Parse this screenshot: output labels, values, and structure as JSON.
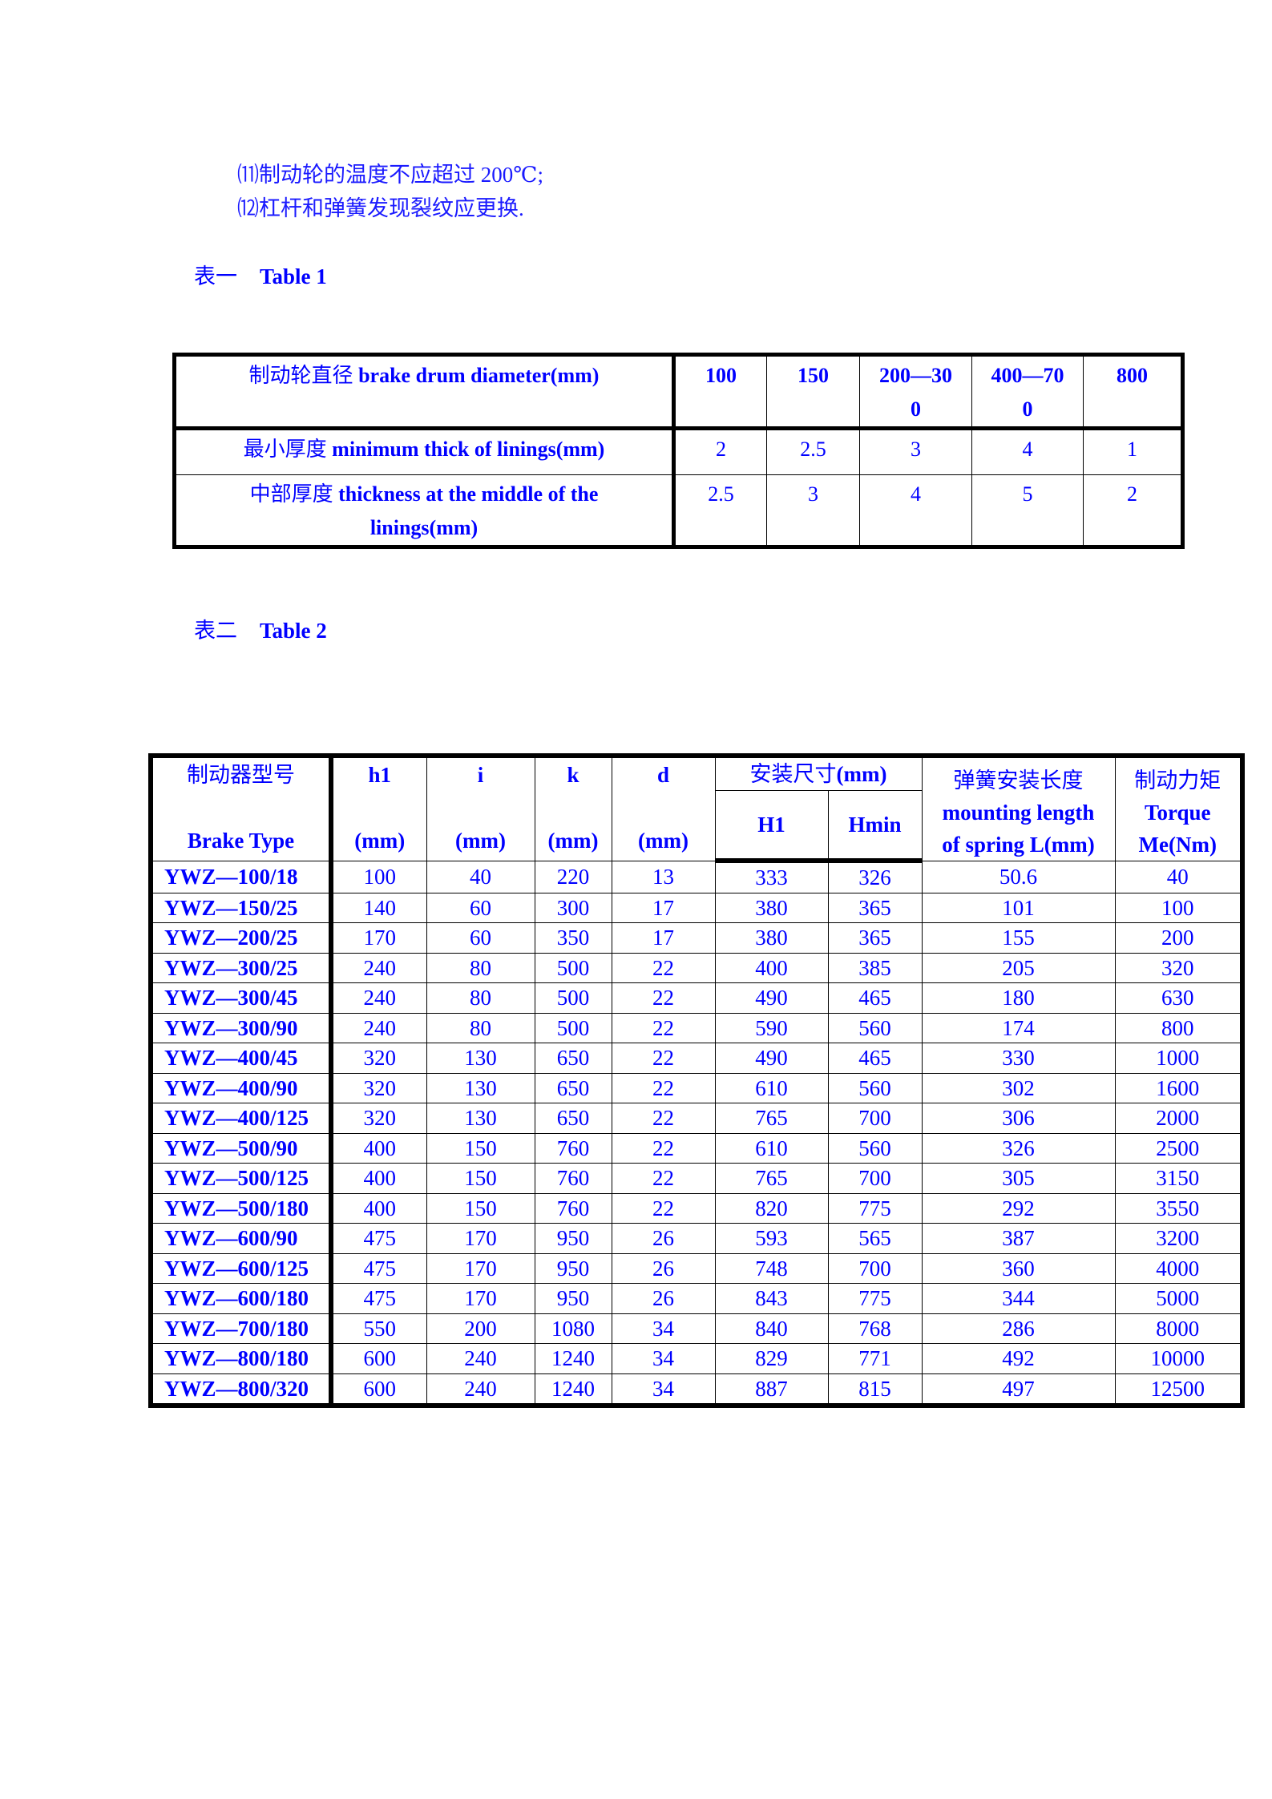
{
  "notes": [
    "⑾制动轮的温度不应超过 200℃;",
    "⑿杠杆和弹簧发现裂纹应更换."
  ],
  "table1": {
    "caption_cn": "表一",
    "caption_en": "Table 1",
    "header_label_cn": "制动轮直径",
    "header_label_en": " brake drum diameter(mm)",
    "columns": [
      "100",
      "150",
      "200—30\n0",
      "400—70\n0",
      "800"
    ],
    "rows": [
      {
        "label_cn": "最小厚度",
        "label_en": " minimum thick of linings(mm)",
        "values": [
          "2",
          "2.5",
          "3",
          "4",
          "1"
        ]
      },
      {
        "label_cn": "中部厚度",
        "label_en": " thickness at the middle of the linings(mm)",
        "values": [
          "2.5",
          "3",
          "4",
          "5",
          "2"
        ]
      }
    ]
  },
  "table2": {
    "caption_cn": "表二",
    "caption_en": "Table 2",
    "headers": {
      "type_cn": "制动器型号",
      "type_en": "Brake Type",
      "h1": "h1",
      "i": "i",
      "k": "k",
      "d": "d",
      "unit": "(mm)",
      "install_cn": "安装尺寸",
      "install_unit": "(mm)",
      "H1": "H1",
      "Hmin": "Hmin",
      "spring_cn": "弹簧安装长度",
      "spring_en1": "mounting length",
      "spring_en2": "of spring L(mm)",
      "torque_cn": "制动力矩",
      "torque_en1": "Torque",
      "torque_en2": "Me(Nm)"
    },
    "rows": [
      [
        "YWZ—100/18",
        "100",
        "40",
        "220",
        "13",
        "333",
        "326",
        "50.6",
        "40"
      ],
      [
        "YWZ—150/25",
        "140",
        "60",
        "300",
        "17",
        "380",
        "365",
        "101",
        "100"
      ],
      [
        "YWZ—200/25",
        "170",
        "60",
        "350",
        "17",
        "380",
        "365",
        "155",
        "200"
      ],
      [
        "YWZ—300/25",
        "240",
        "80",
        "500",
        "22",
        "400",
        "385",
        "205",
        "320"
      ],
      [
        "YWZ—300/45",
        "240",
        "80",
        "500",
        "22",
        "490",
        "465",
        "180",
        "630"
      ],
      [
        "YWZ—300/90",
        "240",
        "80",
        "500",
        "22",
        "590",
        "560",
        "174",
        "800"
      ],
      [
        "YWZ—400/45",
        "320",
        "130",
        "650",
        "22",
        "490",
        "465",
        "330",
        "1000"
      ],
      [
        "YWZ—400/90",
        "320",
        "130",
        "650",
        "22",
        "610",
        "560",
        "302",
        "1600"
      ],
      [
        "YWZ—400/125",
        "320",
        "130",
        "650",
        "22",
        "765",
        "700",
        "306",
        "2000"
      ],
      [
        "YWZ—500/90",
        "400",
        "150",
        "760",
        "22",
        "610",
        "560",
        "326",
        "2500"
      ],
      [
        "YWZ—500/125",
        "400",
        "150",
        "760",
        "22",
        "765",
        "700",
        "305",
        "3150"
      ],
      [
        "YWZ—500/180",
        "400",
        "150",
        "760",
        "22",
        "820",
        "775",
        "292",
        "3550"
      ],
      [
        "YWZ—600/90",
        "475",
        "170",
        "950",
        "26",
        "593",
        "565",
        "387",
        "3200"
      ],
      [
        "YWZ—600/125",
        "475",
        "170",
        "950",
        "26",
        "748",
        "700",
        "360",
        "4000"
      ],
      [
        "YWZ—600/180",
        "475",
        "170",
        "950",
        "26",
        "843",
        "775",
        "344",
        "5000"
      ],
      [
        "YWZ—700/180",
        "550",
        "200",
        "1080",
        "34",
        "840",
        "768",
        "286",
        "8000"
      ],
      [
        "YWZ—800/180",
        "600",
        "240",
        "1240",
        "34",
        "829",
        "771",
        "492",
        "10000"
      ],
      [
        "YWZ—800/320",
        "600",
        "240",
        "1240",
        "34",
        "887",
        "815",
        "497",
        "12500"
      ]
    ]
  }
}
